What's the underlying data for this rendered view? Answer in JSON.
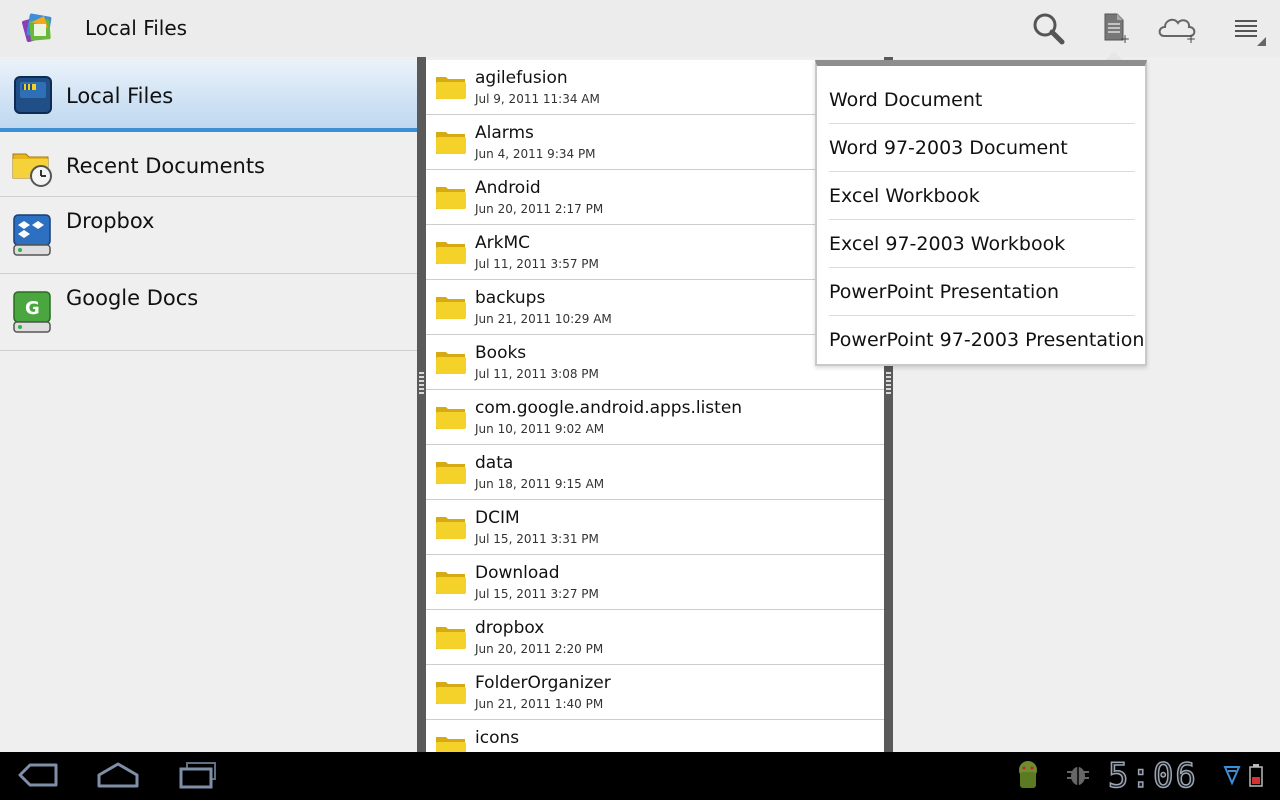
{
  "app": {
    "title": "Local Files",
    "icon": "office-suite-app-icon"
  },
  "actionbar": {
    "actions": [
      "search-icon",
      "new-document-icon",
      "cloud-add-icon",
      "overflow-menu-icon"
    ]
  },
  "nav": {
    "items": [
      {
        "label": "Local Files",
        "icon": "sd-card-icon",
        "selected": true
      },
      {
        "label": "Recent Documents",
        "icon": "recent-folder-clock-icon",
        "selected": false
      },
      {
        "label": "Dropbox",
        "icon": "dropbox-drive-icon",
        "selected": false
      },
      {
        "label": "Google Docs",
        "icon": "google-docs-drive-icon",
        "selected": false
      }
    ]
  },
  "files": [
    {
      "name": "agilefusion",
      "date": "Jul 9, 2011 11:34 AM"
    },
    {
      "name": "Alarms",
      "date": "Jun 4, 2011 9:34 PM"
    },
    {
      "name": "Android",
      "date": "Jun 20, 2011 2:17 PM"
    },
    {
      "name": "ArkMC",
      "date": "Jul 11, 2011 3:57 PM"
    },
    {
      "name": "backups",
      "date": "Jun 21, 2011 10:29 AM"
    },
    {
      "name": "Books",
      "date": "Jul 11, 2011 3:08 PM"
    },
    {
      "name": "com.google.android.apps.listen",
      "date": "Jun 10, 2011 9:02 AM"
    },
    {
      "name": "data",
      "date": "Jun 18, 2011 9:15 AM"
    },
    {
      "name": "DCIM",
      "date": "Jul 15, 2011 3:31 PM"
    },
    {
      "name": "Download",
      "date": "Jul 15, 2011 3:27 PM"
    },
    {
      "name": "dropbox",
      "date": "Jun 20, 2011 2:20 PM"
    },
    {
      "name": "FolderOrganizer",
      "date": "Jun 21, 2011 1:40 PM"
    },
    {
      "name": "icons",
      "date": ""
    }
  ],
  "new_document_menu": {
    "items": [
      "Word Document",
      "Word 97-2003 Document",
      "Excel Workbook",
      "Excel 97-2003 Workbook",
      "PowerPoint Presentation",
      "PowerPoint 97-2003 Presentation"
    ]
  },
  "system_bar": {
    "clock": "5:06",
    "buttons": [
      "back-icon",
      "home-icon",
      "recent-apps-icon"
    ],
    "notifications": [
      "android-notification-icon",
      "usb-debug-icon"
    ],
    "status": [
      "wifi-icon",
      "battery-icon"
    ]
  },
  "colors": {
    "selection_accent": "#3d8fd4",
    "folder": "#f2cf1f",
    "divider": "#5a5a5a"
  }
}
